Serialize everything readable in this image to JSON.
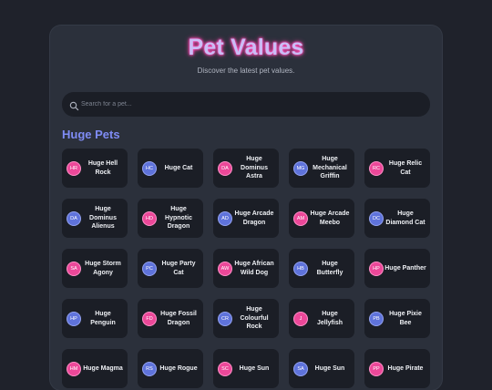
{
  "header": {
    "title": "Pet Values",
    "subtitle": "Discover the latest pet values."
  },
  "search": {
    "placeholder": "Search for a pet...",
    "value": ""
  },
  "section": {
    "title": "Huge Pets"
  },
  "colors": {
    "accent": "#7f8cf5",
    "pink": "#ec4899",
    "blue": "#5f73db"
  },
  "pets": [
    {
      "initials": "HR",
      "name": "Huge Hell Rock",
      "color": "pink"
    },
    {
      "initials": "HC",
      "name": "Huge Cat",
      "color": "blue"
    },
    {
      "initials": "DA",
      "name": "Huge Dominus Astra",
      "color": "pink"
    },
    {
      "initials": "MG",
      "name": "Huge Mechanical Griffin",
      "color": "blue"
    },
    {
      "initials": "RC",
      "name": "Huge Relic Cat",
      "color": "pink"
    },
    {
      "initials": "DA",
      "name": "Huge Dominus Alienus",
      "color": "blue"
    },
    {
      "initials": "HD",
      "name": "Huge Hypnotic Dragon",
      "color": "pink"
    },
    {
      "initials": "AD",
      "name": "Huge Arcade Dragon",
      "color": "blue"
    },
    {
      "initials": "AM",
      "name": "Huge Arcade Meebo",
      "color": "pink"
    },
    {
      "initials": "DC",
      "name": "Huge Diamond Cat",
      "color": "blue"
    },
    {
      "initials": "SA",
      "name": "Huge Storm Agony",
      "color": "pink"
    },
    {
      "initials": "PC",
      "name": "Huge Party Cat",
      "color": "blue"
    },
    {
      "initials": "AW",
      "name": "Huge African Wild Dog",
      "color": "pink"
    },
    {
      "initials": "HB",
      "name": "Huge Butterfly",
      "color": "blue"
    },
    {
      "initials": "HP",
      "name": "Huge Panther",
      "color": "pink"
    },
    {
      "initials": "HP",
      "name": "Huge Penguin",
      "color": "blue"
    },
    {
      "initials": "FD",
      "name": "Huge Fossil Dragon",
      "color": "pink"
    },
    {
      "initials": "CR",
      "name": "Huge Colourful Rock",
      "color": "blue"
    },
    {
      "initials": "J",
      "name": "Huge Jellyfish",
      "color": "pink"
    },
    {
      "initials": "PB",
      "name": "Huge Pixie Bee",
      "color": "blue"
    },
    {
      "initials": "HM",
      "name": "Huge Magma",
      "color": "pink"
    },
    {
      "initials": "RS",
      "name": "Huge Rogue",
      "color": "blue"
    },
    {
      "initials": "SC",
      "name": "Huge Sun",
      "color": "pink"
    },
    {
      "initials": "SA",
      "name": "Huge Sun",
      "color": "blue"
    },
    {
      "initials": "PP",
      "name": "Huge Pirate",
      "color": "pink"
    }
  ]
}
